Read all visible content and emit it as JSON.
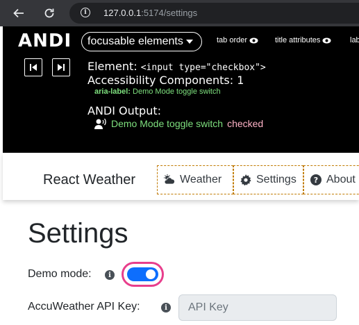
{
  "browser": {
    "url_host": "127.0.0.1",
    "url_rest": ":5174/settings",
    "info_glyph": "i"
  },
  "andi": {
    "logo": "ANDI",
    "module_select": "focusable elements",
    "toggles": [
      "tab order",
      "title attributes",
      "lab"
    ],
    "element_label": "Element:",
    "element_value": "<input type=\"checkbox\">",
    "accessibility_components": "Accessibility Components: 1",
    "aria_label_key": "aria-label:",
    "aria_label_value": "Demo Mode toggle switch",
    "output_title": "ANDI Output:",
    "output_name": "Demo Mode toggle switch",
    "output_state": "checked",
    "colors": {
      "output_name": "#7ee07e",
      "output_state": "#ffb3c7"
    }
  },
  "app": {
    "brand": "React Weather",
    "nav": [
      {
        "label": "Weather",
        "icon": "cloud-sun-icon"
      },
      {
        "label": "Settings",
        "icon": "gear-icon"
      },
      {
        "label": "About",
        "icon": "question-circle-icon"
      }
    ]
  },
  "settings": {
    "title": "Settings",
    "demo_label": "Demo mode:",
    "demo_checked": true,
    "api_key_label": "AccuWeather API Key:",
    "api_key_placeholder": "API Key",
    "info_glyph": "i",
    "colors": {
      "switch_on": "#0d6efd",
      "focus_outline": "#e83e8c"
    }
  }
}
